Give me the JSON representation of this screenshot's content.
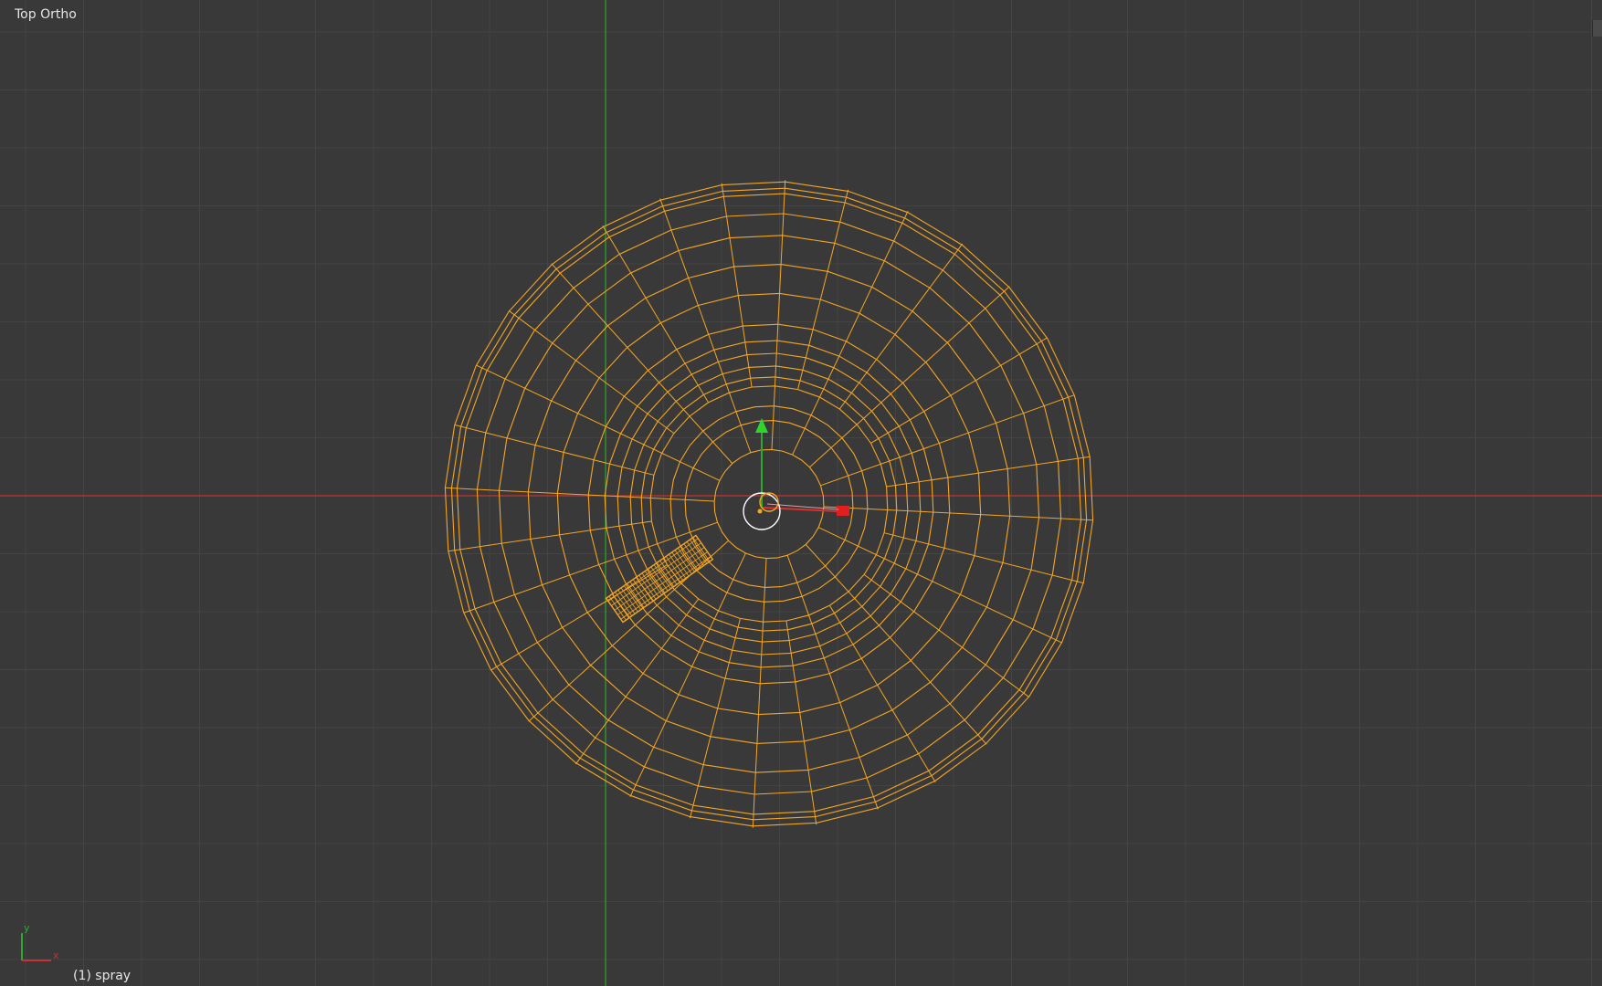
{
  "viewport": {
    "view_name": "Top Ortho",
    "active_object": "(1) spray"
  },
  "axes": {
    "x_label": "x",
    "y_label": "y",
    "x_color": "#c83232",
    "y_color": "#2fa82f"
  },
  "colors": {
    "background": "#393939",
    "grid": "#444444",
    "wire": "#f5a623",
    "origin": "#ffffff"
  },
  "icons": {
    "corner_widget": "area-split-handle-icon",
    "origin": "object-origin-icon",
    "gizmo": "transform-gizmo-icon"
  }
}
